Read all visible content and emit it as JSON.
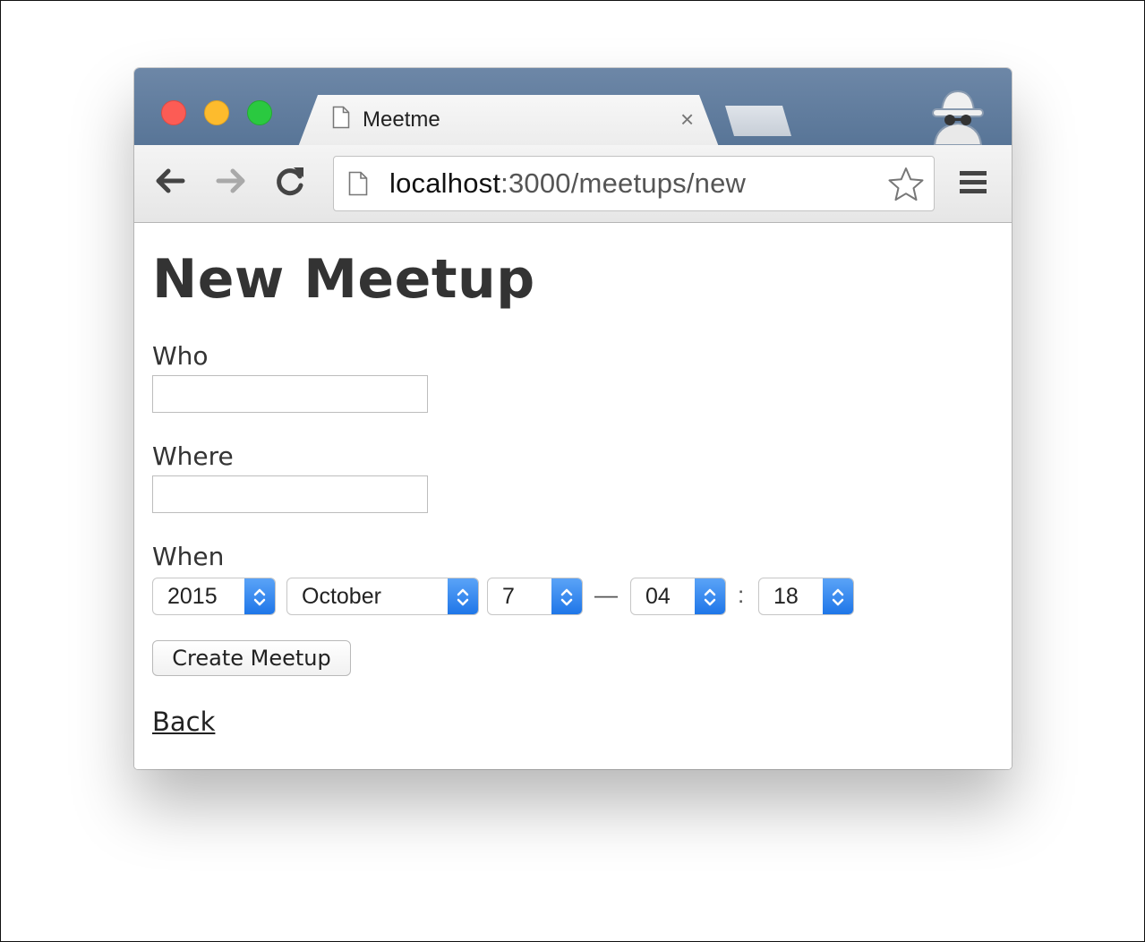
{
  "browser": {
    "tab": {
      "title": "Meetme",
      "close_glyph": "×",
      "doc_icon": "page-icon"
    },
    "url": {
      "host": "localhost",
      "rest": ":3000/meetups/new"
    },
    "icons": [
      "back-arrow-icon",
      "forward-arrow-icon",
      "reload-icon",
      "page-icon",
      "star-icon",
      "menu-icon",
      "incognito-icon"
    ]
  },
  "page": {
    "title": "New Meetup",
    "who": {
      "label": "Who",
      "value": ""
    },
    "where": {
      "label": "Where",
      "value": ""
    },
    "when": {
      "label": "When",
      "year": "2015",
      "month": "October",
      "day": "7",
      "date_time_separator": "—",
      "hour": "04",
      "time_separator": ":",
      "minute": "18"
    },
    "submit_label": "Create Meetup",
    "back_label": "Back"
  },
  "colors": {
    "titlebar": "#5f7b9c",
    "select_arrow": "#2b7cf0",
    "heading_text": "#333333"
  }
}
